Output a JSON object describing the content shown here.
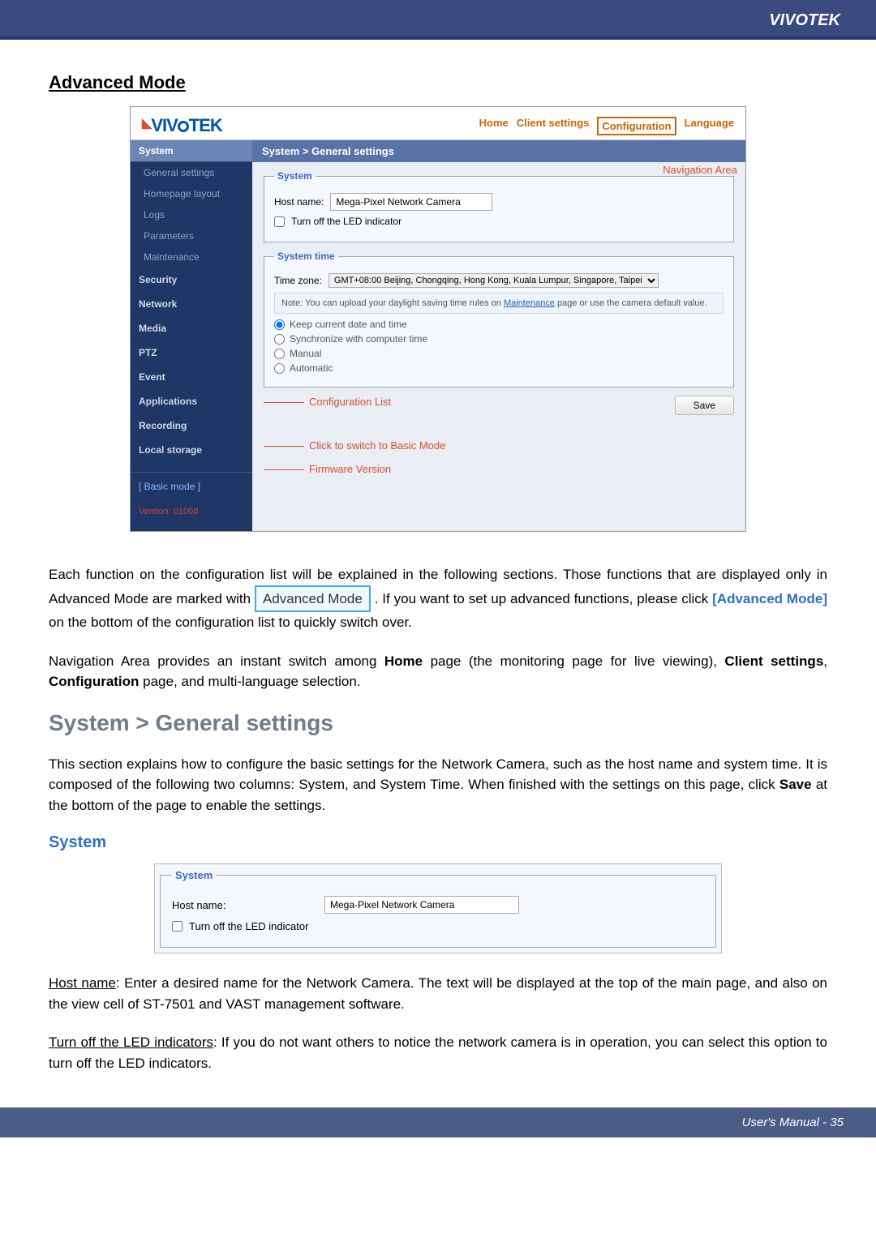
{
  "brand": "VIVOTEK",
  "page_title": "Advanced Mode",
  "screenshot": {
    "logo_text": "VIVOTEK",
    "nav": {
      "home": "Home",
      "client": "Client settings",
      "config": "Configuration",
      "lang": "Language"
    },
    "annot_nav": "Navigation Area",
    "annot_conf": "Configuration List",
    "annot_basic": "Click to switch to Basic Mode",
    "annot_fw": "Firmware Version",
    "breadcrumb": "System  >  General settings",
    "sidebar": {
      "system": "System",
      "items": [
        "General settings",
        "Homepage layout",
        "Logs",
        "Parameters",
        "Maintenance"
      ],
      "security": "Security",
      "network": "Network",
      "media": "Media",
      "ptz": "PTZ",
      "event": "Event",
      "applications": "Applications",
      "recording": "Recording",
      "local_storage": "Local storage",
      "basic_mode": "[ Basic mode ]",
      "version": "Version: 0100d"
    },
    "system_box": {
      "legend": "System",
      "host_label": "Host name:",
      "host_value": "Mega-Pixel Network Camera",
      "led_label": "Turn off the LED indicator"
    },
    "time_box": {
      "legend": "System time",
      "tz_label": "Time zone:",
      "tz_value": "GMT+08:00 Beijing, Chongqing, Hong Kong, Kuala Lumpur, Singapore, Taipei",
      "note_pre": "Note: You can upload your daylight saving time rules on ",
      "note_link": "Maintenance",
      "note_post": " page or use the camera default value.",
      "r_keep": "Keep current date and time",
      "r_sync": "Synchronize with computer time",
      "r_manual": "Manual",
      "r_auto": "Automatic",
      "save": "Save"
    }
  },
  "para1_a": "Each function on the configuration list will be explained in the following sections. Those functions that are displayed only in Advanced Mode are marked with ",
  "para1_badge": "Advanced Mode",
  "para1_b": ". If you want to set up advanced functions, please click ",
  "para1_link": "[Advanced Mode]",
  "para1_c": " on the bottom of the configuration list to quickly switch over.",
  "para2_a": "Navigation Area provides an instant switch among ",
  "para2_home": "Home",
  "para2_b": " page (the monitoring page for live viewing), ",
  "para2_client": "Client settings",
  "para2_c": ", ",
  "para2_config": "Configuration",
  "para2_d": " page, and multi-language selection.",
  "h2": "System > General settings",
  "para3_a": "This section explains how to configure the basic settings for the Network Camera, such as the host name and system time. It is composed of the following two columns: System, and System Time. When finished with the settings on this page, click ",
  "para3_save": "Save",
  "para3_b": " at the bottom of the page to enable the settings.",
  "sub_system": "System",
  "snippet": {
    "legend": "System",
    "host_label": "Host name:",
    "host_value": "Mega-Pixel Network Camera",
    "led_label": "Turn off the LED indicator"
  },
  "para4_label": "Host name",
  "para4_a": ": Enter a desired name for the Network Camera. The text will be displayed at the top of the main page, and also on the view cell of ST-7501 and VAST management software.",
  "para5_label": "Turn off the LED indicators",
  "para5_a": ": If you do not want others to notice the network camera is in operation, you can select this option to turn off the LED indicators.",
  "footer_a": "User's Manual - ",
  "footer_page": "35"
}
